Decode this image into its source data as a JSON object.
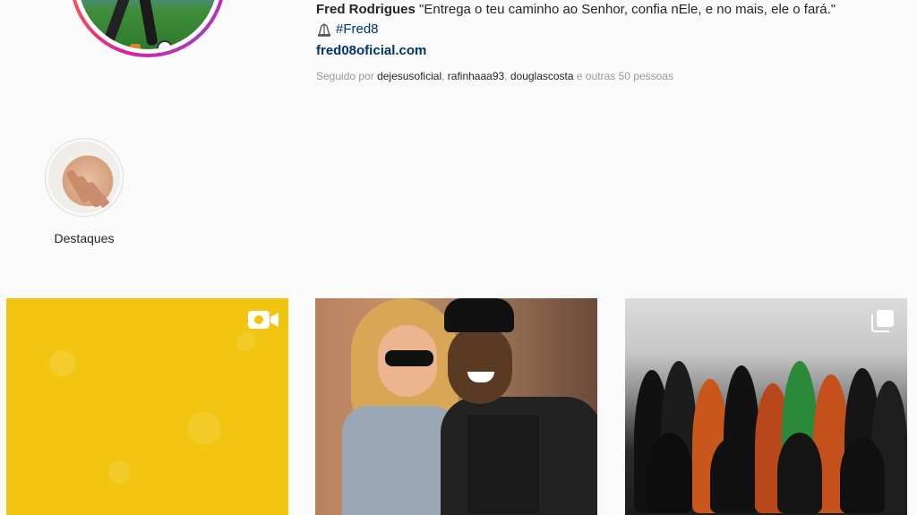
{
  "profile": {
    "display_name": "Fred Rodrigues",
    "bio_text": " \"Entrega o teu caminho ao Senhor, confia nEle, e no mais, ele o fará.\"",
    "hashtag": "#Fred8",
    "website": "fred08oficial.com",
    "followed_by": {
      "prefix": "Seguido por ",
      "users": [
        "dejesusoficial",
        "rafinhaaa93",
        "douglascosta"
      ],
      "suffix": " e outras 50 pessoas"
    }
  },
  "highlights": [
    {
      "label": "Destaques"
    }
  ],
  "posts": [
    {
      "type": "video",
      "icon": "video-camera-icon",
      "color": "#f2c510"
    },
    {
      "type": "photo"
    },
    {
      "type": "carousel",
      "icon": "multiple-photos-icon"
    }
  ],
  "colors": {
    "link": "#003569",
    "muted": "#999999",
    "text": "#262626",
    "background": "#fafafa"
  }
}
